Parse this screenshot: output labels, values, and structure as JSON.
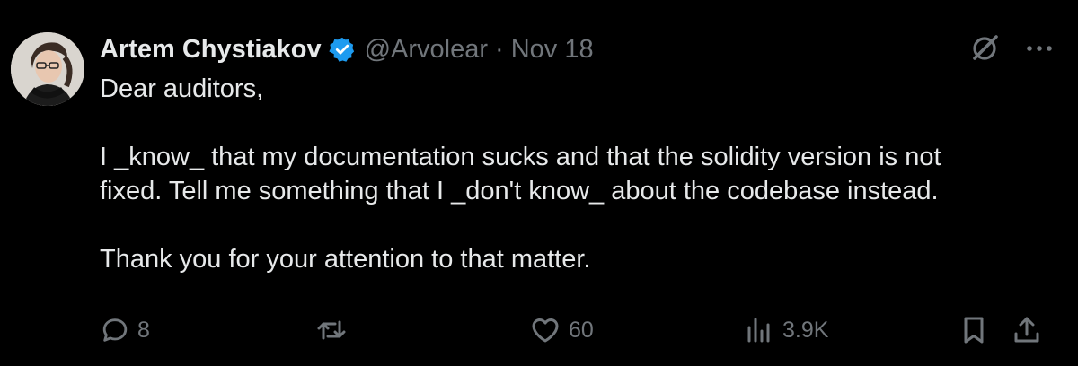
{
  "author": {
    "name": "Artem Chystiakov",
    "handle": "@Arvolear",
    "separator": "·",
    "date": "Nov 18",
    "verified": true,
    "avatar_icon": "avatar-photo"
  },
  "tweet": {
    "lines": [
      "Dear auditors,",
      "I _know_ that my documentation sucks and that the solidity version is not",
      "fixed. Tell me something that I _don't know_ about the codebase instead.",
      "Thank you for your attention to that matter."
    ]
  },
  "metrics": {
    "replies": "8",
    "retweets": "",
    "likes": "60",
    "views": "3.9K"
  },
  "icons": {
    "verified": "verified-badge-icon",
    "grok": "grok-icon",
    "more": "more-options-icon",
    "reply": "reply-icon",
    "retweet": "retweet-icon",
    "like": "heart-icon",
    "views": "views-chart-icon",
    "bookmark": "bookmark-icon",
    "share": "share-icon"
  },
  "colors": {
    "background": "#000000",
    "text": "#e7e9ea",
    "secondary": "#71767b",
    "verified": "#1d9bf0"
  }
}
